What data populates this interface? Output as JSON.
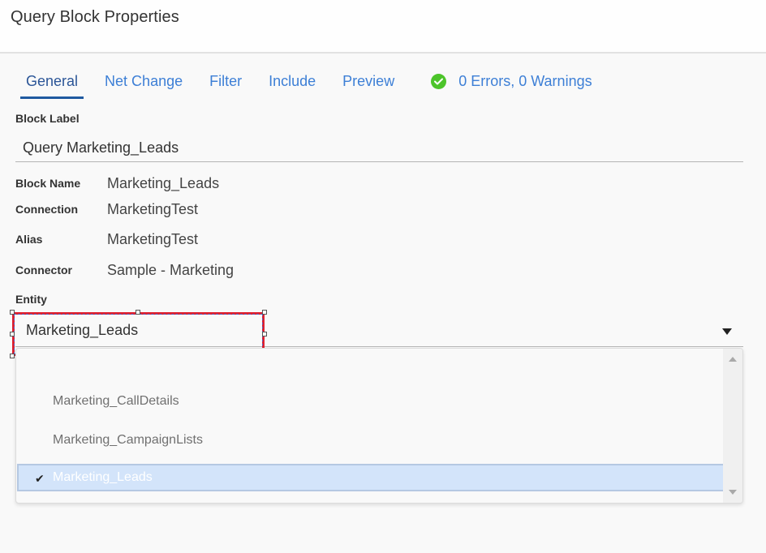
{
  "header": {
    "title": "Query Block Properties"
  },
  "tabs": [
    {
      "label": "General",
      "active": true
    },
    {
      "label": "Net Change",
      "active": false
    },
    {
      "label": "Filter",
      "active": false
    },
    {
      "label": "Include",
      "active": false
    },
    {
      "label": "Preview",
      "active": false
    }
  ],
  "status": {
    "icon": "check-circle-icon",
    "text": "0 Errors, 0 Warnings",
    "color": "#4cc42a"
  },
  "block_label": {
    "label": "Block Label",
    "value": "Query Marketing_Leads"
  },
  "properties": [
    {
      "key": "Block Name",
      "value": "Marketing_Leads"
    },
    {
      "key": "Connection",
      "value": "MarketingTest"
    },
    {
      "key": "Alias",
      "value": "MarketingTest"
    },
    {
      "key": "Connector",
      "value": "Sample - Marketing"
    }
  ],
  "entity": {
    "label": "Entity",
    "value": "Marketing_Leads",
    "options": [
      {
        "label": "Marketing_CallDetails",
        "selected": false
      },
      {
        "label": "Marketing_CampaignLists",
        "selected": false
      },
      {
        "label": "Marketing_Leads",
        "selected": true
      }
    ]
  },
  "colors": {
    "accent": "#3d7fd6",
    "active_tab": "#2b5597",
    "selection_highlight": "#d3e4fa",
    "annotation_border": "#e0202e"
  }
}
